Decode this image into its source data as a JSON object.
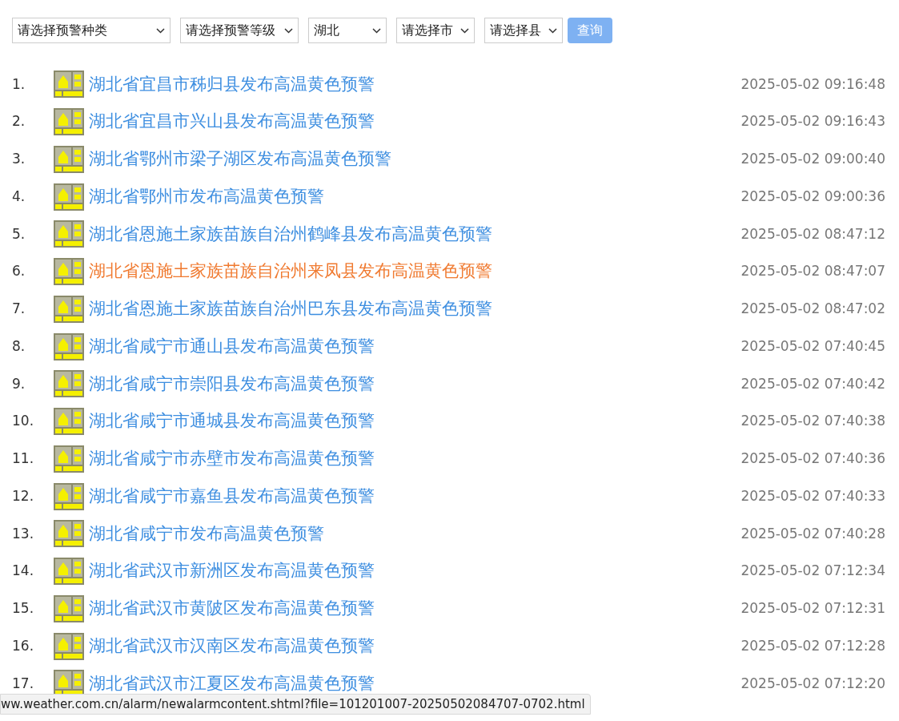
{
  "filters": [
    {
      "value": "请选择预警种类"
    },
    {
      "value": "请选择预警等级"
    },
    {
      "value": "湖北"
    },
    {
      "value": "请选择市"
    },
    {
      "value": "请选择县"
    }
  ],
  "query_button": "查询",
  "alerts": [
    {
      "index": "1.",
      "title": "湖北省宜昌市秭归县发布高温黄色预警",
      "time": "2025-05-02 09:16:48",
      "hovered": false
    },
    {
      "index": "2.",
      "title": "湖北省宜昌市兴山县发布高温黄色预警",
      "time": "2025-05-02 09:16:43",
      "hovered": false
    },
    {
      "index": "3.",
      "title": "湖北省鄂州市梁子湖区发布高温黄色预警",
      "time": "2025-05-02 09:00:40",
      "hovered": false
    },
    {
      "index": "4.",
      "title": "湖北省鄂州市发布高温黄色预警",
      "time": "2025-05-02 09:00:36",
      "hovered": false
    },
    {
      "index": "5.",
      "title": "湖北省恩施土家族苗族自治州鹤峰县发布高温黄色预警",
      "time": "2025-05-02 08:47:12",
      "hovered": false
    },
    {
      "index": "6.",
      "title": "湖北省恩施土家族苗族自治州来凤县发布高温黄色预警",
      "time": "2025-05-02 08:47:07",
      "hovered": true
    },
    {
      "index": "7.",
      "title": "湖北省恩施土家族苗族自治州巴东县发布高温黄色预警",
      "time": "2025-05-02 08:47:02",
      "hovered": false
    },
    {
      "index": "8.",
      "title": "湖北省咸宁市通山县发布高温黄色预警",
      "time": "2025-05-02 07:40:45",
      "hovered": false
    },
    {
      "index": "9.",
      "title": "湖北省咸宁市崇阳县发布高温黄色预警",
      "time": "2025-05-02 07:40:42",
      "hovered": false
    },
    {
      "index": "10.",
      "title": "湖北省咸宁市通城县发布高温黄色预警",
      "time": "2025-05-02 07:40:38",
      "hovered": false
    },
    {
      "index": "11.",
      "title": "湖北省咸宁市赤壁市发布高温黄色预警",
      "time": "2025-05-02 07:40:36",
      "hovered": false
    },
    {
      "index": "12.",
      "title": "湖北省咸宁市嘉鱼县发布高温黄色预警",
      "time": "2025-05-02 07:40:33",
      "hovered": false
    },
    {
      "index": "13.",
      "title": "湖北省咸宁市发布高温黄色预警",
      "time": "2025-05-02 07:40:28",
      "hovered": false
    },
    {
      "index": "14.",
      "title": "湖北省武汉市新洲区发布高温黄色预警",
      "time": "2025-05-02 07:12:34",
      "hovered": false
    },
    {
      "index": "15.",
      "title": "湖北省武汉市黄陂区发布高温黄色预警",
      "time": "2025-05-02 07:12:31",
      "hovered": false
    },
    {
      "index": "16.",
      "title": "湖北省武汉市汉南区发布高温黄色预警",
      "time": "2025-05-02 07:12:28",
      "hovered": false
    },
    {
      "index": "17.",
      "title": "湖北省武汉市江夏区发布高温黄色预警",
      "time": "2025-05-02 07:12:20",
      "hovered": false
    }
  ],
  "status_bar": {
    "url": "ww.weather.com.cn/alarm/newalarmcontent.shtml?file=101201007-20250502084707-0702.html"
  }
}
